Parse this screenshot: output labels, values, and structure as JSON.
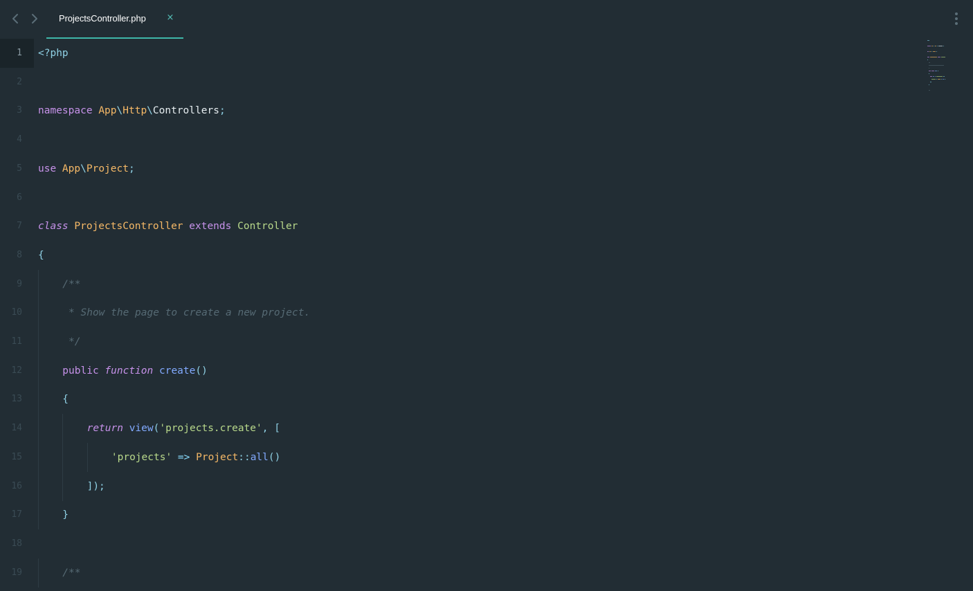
{
  "tabs": [
    {
      "label": "ProjectsController.php",
      "active": true
    }
  ],
  "icons": {
    "back": "chevron-left-icon",
    "forward": "chevron-right-icon",
    "close": "close-icon",
    "menu": "kebab-menu-icon"
  },
  "tab_close_glyph": "×",
  "colors": {
    "background": "#222d34",
    "accent": "#3fb7a9",
    "keyword": "#c792ea",
    "type": "#f6b967",
    "function": "#82aaff",
    "string": "#b9d98b",
    "comment": "#566a74",
    "punctuation": "#8fd0e4"
  },
  "editor": {
    "active_line": 1,
    "lines": [
      {
        "n": "1",
        "indent": 0,
        "tokens": [
          {
            "t": "<?php",
            "c": "punct"
          }
        ]
      },
      {
        "n": "2",
        "indent": 0,
        "tokens": []
      },
      {
        "n": "3",
        "indent": 0,
        "tokens": [
          {
            "t": "namespace ",
            "c": "kw"
          },
          {
            "t": "App",
            "c": "type"
          },
          {
            "t": "\\",
            "c": "punct"
          },
          {
            "t": "Http",
            "c": "type"
          },
          {
            "t": "\\",
            "c": "punct"
          },
          {
            "t": "Controllers",
            "c": "plain"
          },
          {
            "t": ";",
            "c": "punct"
          }
        ]
      },
      {
        "n": "4",
        "indent": 0,
        "tokens": []
      },
      {
        "n": "5",
        "indent": 0,
        "tokens": [
          {
            "t": "use ",
            "c": "kw"
          },
          {
            "t": "App",
            "c": "type"
          },
          {
            "t": "\\",
            "c": "punct"
          },
          {
            "t": "Project",
            "c": "type"
          },
          {
            "t": ";",
            "c": "punct"
          }
        ]
      },
      {
        "n": "6",
        "indent": 0,
        "tokens": []
      },
      {
        "n": "7",
        "indent": 0,
        "tokens": [
          {
            "t": "class ",
            "c": "kwi"
          },
          {
            "t": "ProjectsController ",
            "c": "type"
          },
          {
            "t": "extends ",
            "c": "kw"
          },
          {
            "t": "Controller",
            "c": "str"
          }
        ]
      },
      {
        "n": "8",
        "indent": 0,
        "tokens": [
          {
            "t": "{",
            "c": "punct"
          }
        ]
      },
      {
        "n": "9",
        "indent": 1,
        "tokens": [
          {
            "t": "/**",
            "c": "cmt"
          }
        ]
      },
      {
        "n": "10",
        "indent": 1,
        "tokens": [
          {
            "t": " * Show the page to create a new project.",
            "c": "cmt"
          }
        ]
      },
      {
        "n": "11",
        "indent": 1,
        "tokens": [
          {
            "t": " */",
            "c": "cmt"
          }
        ]
      },
      {
        "n": "12",
        "indent": 1,
        "tokens": [
          {
            "t": "public ",
            "c": "kw"
          },
          {
            "t": "function ",
            "c": "kwi"
          },
          {
            "t": "create",
            "c": "fn"
          },
          {
            "t": "()",
            "c": "punct"
          }
        ]
      },
      {
        "n": "13",
        "indent": 1,
        "tokens": [
          {
            "t": "{",
            "c": "punct"
          }
        ]
      },
      {
        "n": "14",
        "indent": 2,
        "tokens": [
          {
            "t": "return ",
            "c": "kwi"
          },
          {
            "t": "view",
            "c": "fn"
          },
          {
            "t": "(",
            "c": "punct"
          },
          {
            "t": "'projects.create'",
            "c": "str"
          },
          {
            "t": ", [",
            "c": "punct"
          }
        ]
      },
      {
        "n": "15",
        "indent": 3,
        "tokens": [
          {
            "t": "'projects'",
            "c": "str"
          },
          {
            "t": " => ",
            "c": "op"
          },
          {
            "t": "Project",
            "c": "type"
          },
          {
            "t": "::",
            "c": "punct"
          },
          {
            "t": "all",
            "c": "fn"
          },
          {
            "t": "()",
            "c": "punct"
          }
        ]
      },
      {
        "n": "16",
        "indent": 2,
        "tokens": [
          {
            "t": "]);",
            "c": "punct"
          }
        ]
      },
      {
        "n": "17",
        "indent": 1,
        "tokens": [
          {
            "t": "}",
            "c": "punct"
          }
        ]
      },
      {
        "n": "18",
        "indent": 0,
        "tokens": []
      },
      {
        "n": "19",
        "indent": 1,
        "tokens": [
          {
            "t": "/**",
            "c": "cmt"
          }
        ]
      }
    ]
  }
}
